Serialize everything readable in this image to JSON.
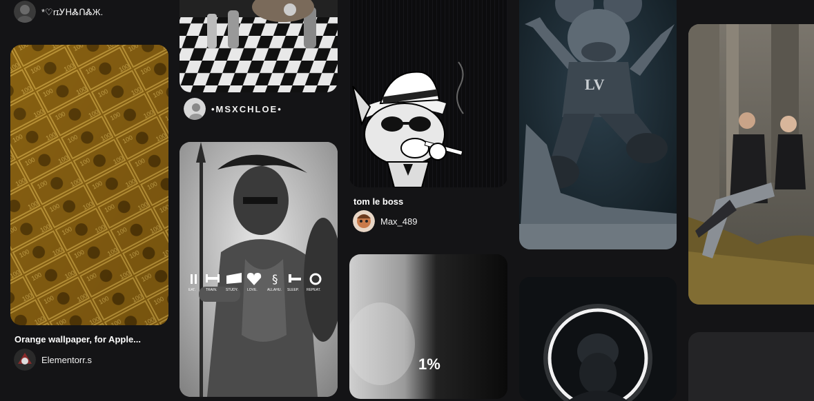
{
  "columns": [
    {
      "top_user": "*♡ꭇɪᎩᕼᏜᑎᏜЖ.",
      "pin": {
        "title": "Orange wallpaper, for Apple...",
        "author": "Elementorr.s",
        "image": "stacks of dollar bills, gold tint"
      }
    },
    {
      "top_pin_image": "chess board with hand",
      "top_user": "•MSXCHLOE•",
      "pin": {
        "image": "spartan warrior with spear",
        "overlay_labels": [
          "EAT.",
          "TRAIN.",
          "STUDY.",
          "LOVE.",
          "ALLAHU.",
          "SLEEP.",
          "REPEAT."
        ]
      }
    },
    {
      "pin": {
        "title": "tom le boss",
        "author": "Max_489",
        "image": "cartoon cat with hat and sunglasses smoking"
      },
      "bottom_pin": {
        "overlay_text": "1%",
        "image": "smoke gradient"
      }
    },
    {
      "pin": {
        "image": "Mickey figure in LV outfit jumping"
      },
      "bottom_pin": {
        "image": "Buddha with neon ring"
      }
    },
    {
      "pin": {
        "image": "couple sitting in ruined building"
      },
      "bottom_pin": {
        "image": "dark placeholder"
      }
    }
  ],
  "colors": {
    "background": "#141416",
    "text": "#ffffff"
  }
}
